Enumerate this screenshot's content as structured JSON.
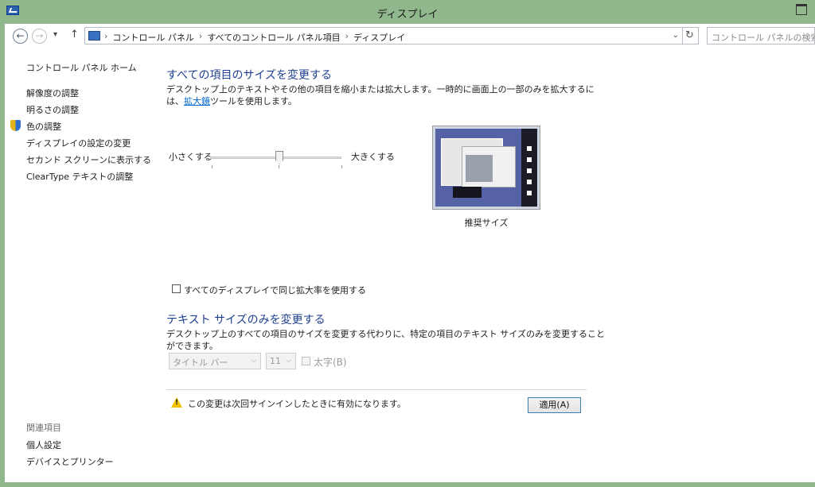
{
  "window": {
    "title": "ディスプレイ"
  },
  "navigation": {
    "back_glyph": "←",
    "forward_glyph": "→",
    "recent_glyph": "▾",
    "up_glyph": "↑",
    "breadcrumbs": [
      "コントロール パネル",
      "すべてのコントロール パネル項目",
      "ディスプレイ"
    ],
    "breadcrumb_separator": "›",
    "dropdown_glyph": "⌄",
    "refresh_glyph": "↻",
    "search_placeholder": "コントロール パネルの検索"
  },
  "sidebar": {
    "home": "コントロール パネル ホーム",
    "items": [
      "解像度の調整",
      "明るさの調整",
      "色の調整",
      "ディスプレイの設定の変更",
      "セカンド スクリーンに表示する",
      "ClearType テキストの調整"
    ],
    "related_title": "関連項目",
    "related_items": [
      "個人設定",
      "デバイスとプリンター"
    ]
  },
  "size_section": {
    "heading": "すべての項目のサイズを変更する",
    "description_before_link": "デスクトップ上のテキストやその他の項目を縮小または拡大します。一時的に画面上の一部のみを拡大するには、",
    "link": "拡大鏡",
    "description_after_link": "ツールを使用します。",
    "slider_min_label": "小さくする",
    "slider_max_label": "大きくする",
    "slider_value": 0.5,
    "preview_caption": "推奨サイズ",
    "same_scale_checkbox": "すべてのディスプレイで同じ拡大率を使用する",
    "same_scale_checked": false
  },
  "text_section": {
    "heading": "テキスト サイズのみを変更する",
    "description": "デスクトップ上のすべての項目のサイズを変更する代わりに、特定の項目のテキスト サイズのみを変更することができます。",
    "item_select": "タイトル バー",
    "size_select": "11",
    "select_arrow": "⌵",
    "bold_label": "太字(B)"
  },
  "footer": {
    "warning": "この変更は次回サインインしたときに有効になります。",
    "apply_button": "適用(A)"
  },
  "colors": {
    "frame": "#90b88c",
    "heading": "#1e3f8f",
    "link": "#0066cc"
  }
}
